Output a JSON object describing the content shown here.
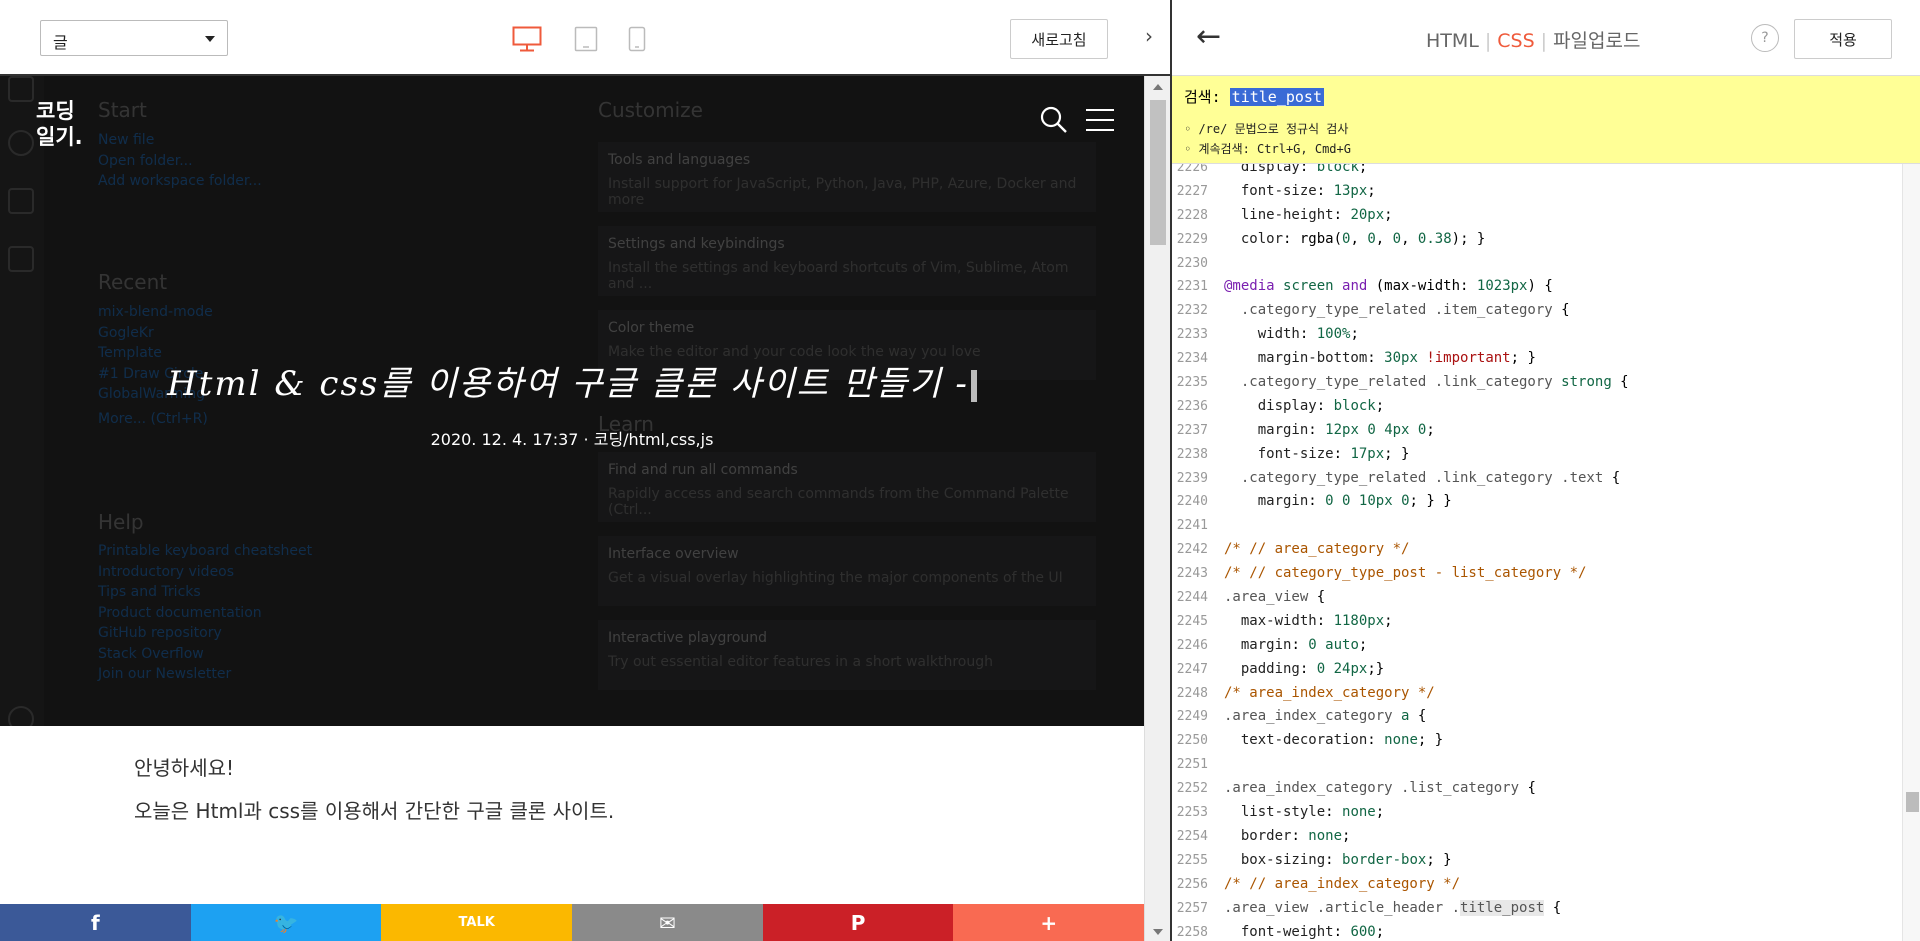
{
  "left_toolbar": {
    "select_value": "글",
    "refresh_label": "새로고침",
    "collapse_label": "›"
  },
  "hero": {
    "logo_line1": "코딩",
    "logo_line2": "일기.",
    "title": "Html & css를 이용하여 구글 클론 사이트 만들기 -",
    "meta": "2020. 12. 4. 17:37 · 코딩/html,css,js",
    "bg_editor": {
      "start_heading": "Start",
      "start_links": [
        "New file",
        "Open folder...",
        "Add workspace folder..."
      ],
      "recent_heading": "Recent",
      "recent_links": [
        "mix-blend-mode",
        "GogleKr",
        "Template",
        "#1 Draw Circle",
        "GlobalWarming",
        "More...   (Ctrl+R)"
      ],
      "help_heading": "Help",
      "help_links": [
        "Printable keyboard cheatsheet",
        "Introductory videos",
        "Tips and Tricks",
        "Product documentation",
        "GitHub repository",
        "Stack Overflow",
        "Join our Newsletter"
      ],
      "customize_heading": "Customize",
      "learn_heading": "Learn",
      "cards": [
        {
          "title": "Tools and languages",
          "desc": "Install support for JavaScript, Python, Java, PHP, Azure, Docker and more"
        },
        {
          "title": "Settings and keybindings",
          "desc": "Install the settings and keyboard shortcuts of Vim, Sublime, Atom and ..."
        },
        {
          "title": "Color theme",
          "desc": "Make the editor and your code look the way you love"
        },
        {
          "title": "Find and run all commands",
          "desc": "Rapidly access and search commands from the Command Palette (Ctrl..."
        },
        {
          "title": "Interface overview",
          "desc": "Get a visual overlay highlighting the major components of the UI"
        },
        {
          "title": "Interactive playground",
          "desc": "Try out essential editor features in a short walkthrough"
        }
      ]
    }
  },
  "article": {
    "line1": "안녕하세요!",
    "line2": "오늘은 Html과 css를 이용해서 간단한 구글 클론 사이트."
  },
  "share": [
    {
      "name": "facebook",
      "label": "f",
      "color": "#3b5998"
    },
    {
      "name": "twitter",
      "label": "🐦",
      "color": "#1da1f2"
    },
    {
      "name": "kakao",
      "label": "TALK",
      "color": "#fbb800"
    },
    {
      "name": "email",
      "label": "✉",
      "color": "#8a8a8a"
    },
    {
      "name": "pinterest",
      "label": "P",
      "color": "#cb2027"
    },
    {
      "name": "more",
      "label": "+",
      "color": "#f96a52"
    }
  ],
  "right_toolbar": {
    "back_label": "←",
    "tabs": [
      "HTML",
      "CSS",
      "파일업로드"
    ],
    "active_tab": "CSS",
    "help_label": "?",
    "apply_label": "적용"
  },
  "search": {
    "label": "검색:",
    "query": "title_post",
    "hint1": "◦ /re/ 문법으로 정규식 검사",
    "hint2": "◦ 계속검색: Ctrl+G, Cmd+G"
  },
  "code_start_line": 2226,
  "colors": {
    "accent": "#ef5a3b",
    "search_bg": "#ffff96",
    "hero_bg": "#1e1e1e"
  }
}
